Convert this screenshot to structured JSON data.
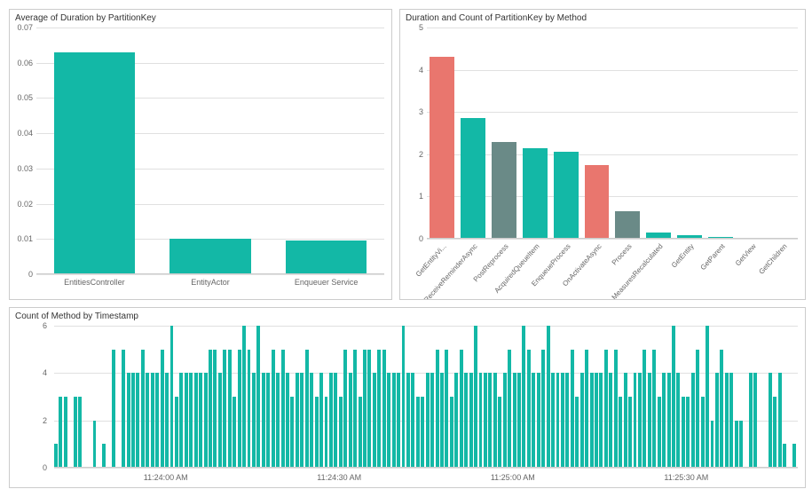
{
  "chart_data": [
    {
      "id": "chart1",
      "type": "bar",
      "title": "Average of Duration by PartitionKey",
      "categories": [
        "EntitiesController",
        "EntityActor",
        "Enqueuer Service"
      ],
      "values": [
        0.063,
        0.01,
        0.0095
      ],
      "ylim": [
        0,
        0.07
      ],
      "yticks": [
        0,
        0.01,
        0.02,
        0.03,
        0.04,
        0.05,
        0.06,
        0.07
      ],
      "bar_color": "#13B8A6"
    },
    {
      "id": "chart2",
      "type": "bar",
      "title": "Duration and Count of PartitionKey by Method",
      "categories": [
        "GetEntityVi...",
        "ReceiveReminderAsync",
        "PostReprocess",
        "AcquiredQueueItem",
        "EnqueueProcess",
        "OnActivateAsync",
        "Process",
        "MeasuresRecalculated",
        "GetEntity",
        "GetParent",
        "GetView",
        "GetChildren"
      ],
      "values": [
        4.3,
        2.85,
        2.3,
        2.15,
        2.05,
        1.75,
        0.65,
        0.15,
        0.08,
        0.05,
        0.03,
        0.02
      ],
      "colors": [
        "#E9766E",
        "#13B8A6",
        "#6A8A87",
        "#13B8A6",
        "#13B8A6",
        "#E9766E",
        "#6A8A87",
        "#13B8A6",
        "#13B8A6",
        "#13B8A6",
        "#13B8A6",
        "#13B8A6"
      ],
      "ylim": [
        0,
        5
      ],
      "yticks": [
        0,
        1,
        2,
        3,
        4,
        5
      ]
    },
    {
      "id": "chart3",
      "type": "bar",
      "title": "Count of Method by Timestamp",
      "x_tick_labels": [
        "11:24:00 AM",
        "11:24:30 AM",
        "11:25:00 AM",
        "11:25:30 AM"
      ],
      "ylim": [
        0,
        6
      ],
      "yticks": [
        0,
        2,
        4,
        6
      ],
      "values": [
        1,
        3,
        3,
        0,
        3,
        3,
        0,
        0,
        2,
        0,
        1,
        0,
        5,
        0,
        5,
        4,
        4,
        4,
        5,
        4,
        4,
        4,
        5,
        4,
        6,
        3,
        4,
        4,
        4,
        4,
        4,
        4,
        5,
        5,
        4,
        5,
        5,
        3,
        5,
        6,
        5,
        4,
        6,
        4,
        4,
        5,
        4,
        5,
        4,
        3,
        4,
        4,
        5,
        4,
        3,
        4,
        3,
        4,
        4,
        3,
        5,
        4,
        5,
        3,
        5,
        5,
        4,
        5,
        5,
        4,
        4,
        4,
        6,
        4,
        4,
        3,
        3,
        4,
        4,
        5,
        4,
        5,
        3,
        4,
        5,
        4,
        4,
        6,
        4,
        4,
        4,
        4,
        3,
        4,
        5,
        4,
        4,
        6,
        5,
        4,
        4,
        5,
        6,
        4,
        4,
        4,
        4,
        5,
        3,
        4,
        5,
        4,
        4,
        4,
        5,
        4,
        5,
        3,
        4,
        3,
        4,
        4,
        5,
        4,
        5,
        3,
        4,
        4,
        6,
        4,
        3,
        3,
        4,
        5,
        3,
        6,
        2,
        4,
        5,
        4,
        4,
        2,
        2,
        0,
        4,
        4,
        0,
        0,
        4,
        3,
        4,
        1,
        0,
        1
      ],
      "bar_color": "#13B8A6"
    }
  ]
}
